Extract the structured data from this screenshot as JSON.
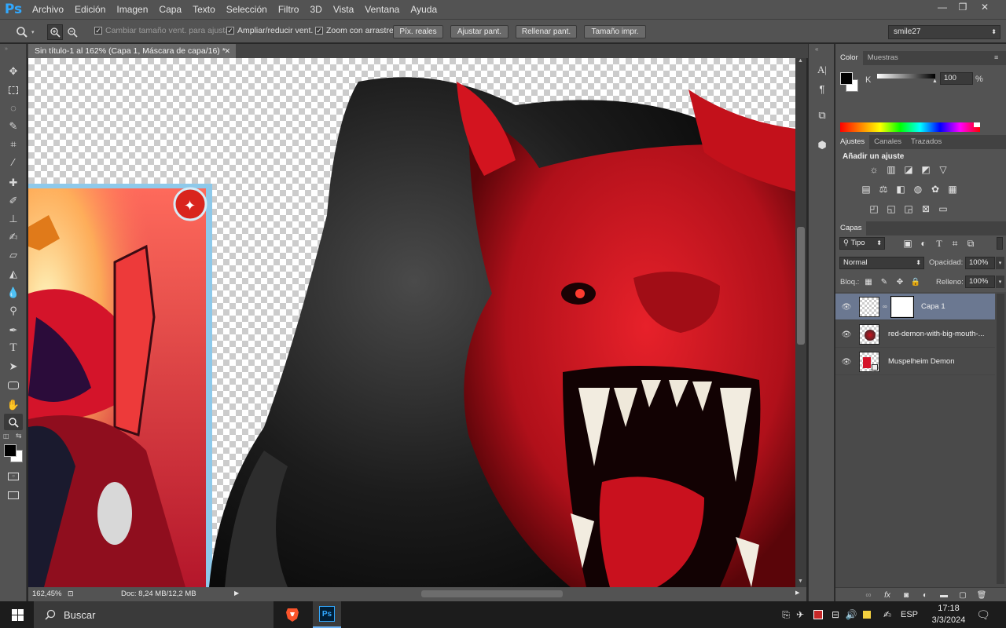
{
  "app": {
    "logo": "Ps"
  },
  "menu": [
    "Archivo",
    "Edición",
    "Imagen",
    "Capa",
    "Texto",
    "Selección",
    "Filtro",
    "3D",
    "Vista",
    "Ventana",
    "Ayuda"
  ],
  "window_controls": {
    "minimize": "—",
    "restore": "❐",
    "close": "✕"
  },
  "options": {
    "resize_window": "Cambiar tamaño vent. para ajustar",
    "zoom_window": "Ampliar/reducir vent.",
    "scrubby_zoom": "Zoom con arrastre",
    "actual_pixels": "Píx. reales",
    "fit_screen": "Ajustar pant.",
    "fill_screen": "Rellenar pant.",
    "print_size": "Tamaño impr.",
    "workspace": "smile27"
  },
  "document": {
    "tab_title": "Sin título-1 al 162% (Capa 1, Máscara de capa/16) *",
    "zoom": "162,45%",
    "doc_size": "Doc: 8,24 MB/12,2 MB"
  },
  "color_panel": {
    "tabs": [
      "Color",
      "Muestras"
    ],
    "channel": "K",
    "value": "100",
    "unit": "%"
  },
  "adjustments_panel": {
    "tabs": [
      "Ajustes",
      "Canales",
      "Trazados"
    ],
    "title": "Añadir un ajuste"
  },
  "layers_panel": {
    "tab": "Capas",
    "filter": "Tipo",
    "blend_mode": "Normal",
    "opacity_label": "Opacidad:",
    "opacity": "100%",
    "lock_label": "Bloq.:",
    "fill_label": "Relleno:",
    "fill": "100%",
    "layers": [
      {
        "name": "Capa 1",
        "selected": true
      },
      {
        "name": "red-demon-with-big-mouth-...",
        "selected": false
      },
      {
        "name": "Muspelheim Demon",
        "selected": false
      }
    ]
  },
  "taskbar": {
    "search": "Buscar",
    "language": "ESP",
    "time": "17:18",
    "date": "3/3/2024"
  }
}
